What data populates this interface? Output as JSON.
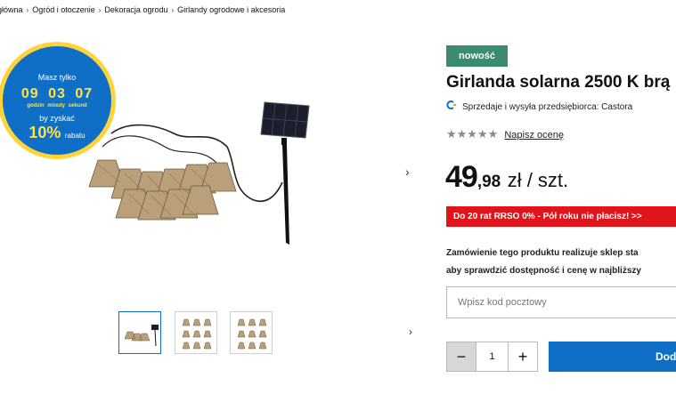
{
  "breadcrumb": [
    {
      "label": "główna"
    },
    {
      "label": "Ogród i otoczenie"
    },
    {
      "label": "Dekoracja ogrodu"
    },
    {
      "label": "Girlandy ogrodowe i akcesoria"
    }
  ],
  "breadcrumb_separator": "›",
  "promo": {
    "line1": "Masz tylko",
    "timer": {
      "hours": "09",
      "minutes": "03",
      "seconds": "07"
    },
    "units": "godzin minuty sekund",
    "line2": "by zyskać",
    "discount": "10%",
    "discount_label": "rabatu",
    "colors": {
      "circle": "#0f6fc6",
      "ring": "#ffd43b",
      "highlight": "#ffe14a"
    }
  },
  "gallery": {
    "arrow_icon": "chevron-right-icon",
    "arrow_glyph": "›",
    "thumbnails": [
      {
        "name": "thumbnail-1",
        "active": true
      },
      {
        "name": "thumbnail-2",
        "active": false
      },
      {
        "name": "thumbnail-3",
        "active": false
      }
    ]
  },
  "product": {
    "badge": "nowość",
    "title": "Girlanda solarna 2500 K brą",
    "seller_text": "Sprzedaje i wysyła przedsiębiorca: Castora",
    "rating_stars": "★★★★★",
    "review_link": "Napisz ocenę",
    "price_int": "49",
    "price_dec": ",98",
    "price_unit": "zł / szt.",
    "promo_bar": "Do 20 rat RRSO 0% - Pół roku nie płacisz! >>",
    "info_line1": "Zamówienie tego produktu realizuje sklep sta",
    "info_line2": "aby sprawdzić dostępność i cenę w najbliższy",
    "postcode_placeholder": "Wpisz kod pocztowy",
    "quantity": "1",
    "minus_label": "−",
    "plus_label": "+",
    "add_label": "Dod"
  },
  "colors": {
    "badge": "#3a8c70",
    "promo_bar": "#e0151b",
    "primary": "#0f6fc6",
    "stars": "#8a8a8a"
  }
}
